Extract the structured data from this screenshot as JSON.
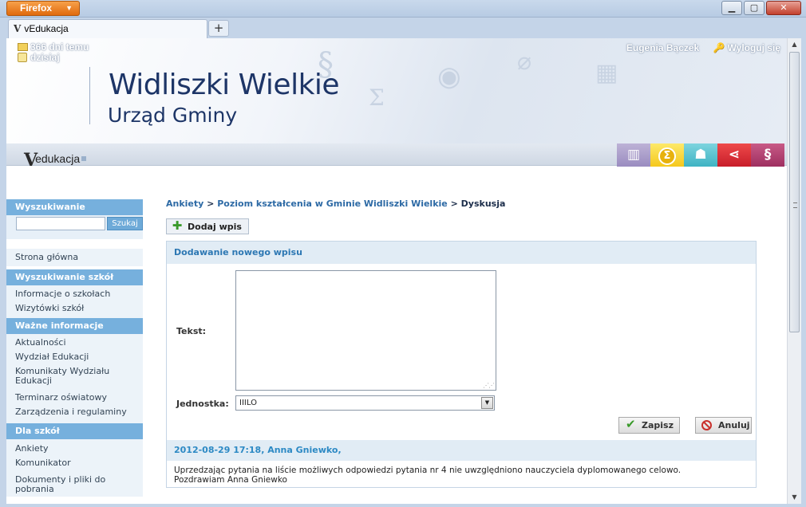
{
  "browser": {
    "menu_button": "Firefox",
    "tab_title": "vEdukacja",
    "new_tab": "+",
    "window_controls": {
      "minimize": "▁",
      "maximize": "▢",
      "close": "✕"
    }
  },
  "header": {
    "notice_line1": "366 dni temu",
    "notice_line2": "dzisiaj",
    "user_name": "Eugenia Bączek",
    "logout": "Wyloguj się",
    "city": "Widliszki Wielkie",
    "office": "Urząd Gminy",
    "logo_text": "edukacja",
    "logo_mark": "V",
    "module_icons": [
      "books-icon",
      "sigma-icon",
      "people-icon",
      "share-icon",
      "paragraph-icon"
    ]
  },
  "sidebar": {
    "search_heading": "Wyszukiwanie",
    "search_button": "Szukaj",
    "search_value": "",
    "home": "Strona główna",
    "groups": [
      {
        "title": "Wyszukiwanie szkół",
        "items": [
          "Informacje o szkołach",
          "Wizytówki szkół"
        ]
      },
      {
        "title": "Ważne informacje",
        "items": [
          "Aktualności",
          "Wydział Edukacji",
          "Komunikaty Wydziału Edukacji",
          "Terminarz oświatowy",
          "Zarządzenia i regulaminy"
        ]
      },
      {
        "title": "Dla szkół",
        "items": [
          "Ankiety",
          "Komunikator",
          "Dokumenty i pliki do pobrania"
        ]
      }
    ]
  },
  "main": {
    "breadcrumb": {
      "item1": "Ankiety",
      "sep": ">",
      "item2": "Poziom kształcenia w Gminie Widliszki Wielkie",
      "current": "Dyskusja"
    },
    "add_button": "Dodaj wpis",
    "form": {
      "heading": "Dodawanie nowego wpisu",
      "text_label": "Tekst:",
      "text_value": "",
      "unit_label": "Jednostka:",
      "unit_value": "IIILO",
      "save": "Zapisz",
      "cancel": "Anuluj"
    },
    "entry": {
      "header": "2012-08-29 17:18, Anna Gniewko,",
      "line1": "Uprzedzając pytania na liście możliwych odpowiedzi pytania nr 4 nie uwzględniono nauczyciela dyplomowanego celowo.",
      "line2": "Pozdrawiam Anna Gniewko"
    }
  }
}
